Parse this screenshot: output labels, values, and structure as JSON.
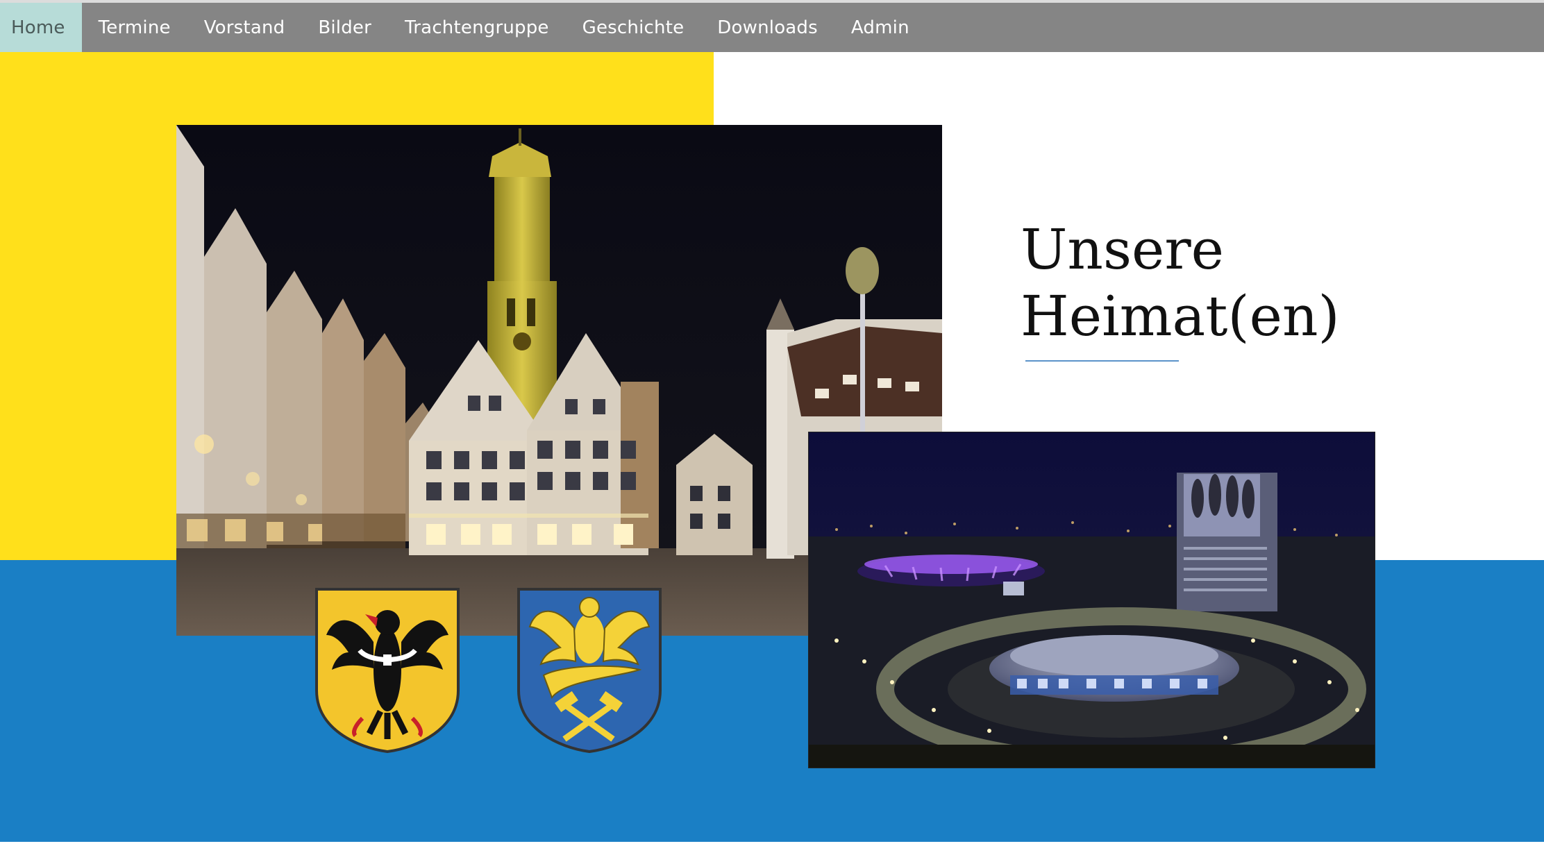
{
  "nav": {
    "items": [
      {
        "label": "Home",
        "active": true
      },
      {
        "label": "Termine"
      },
      {
        "label": "Vorstand"
      },
      {
        "label": "Bilder"
      },
      {
        "label": "Trachtengruppe"
      },
      {
        "label": "Geschichte"
      },
      {
        "label": "Downloads"
      },
      {
        "label": "Admin"
      }
    ]
  },
  "hero": {
    "title_line1": "Unsere",
    "title_line2": "Heimat(en)"
  },
  "colors": {
    "yellow": "#ffe01b",
    "blue": "#1a7fc5",
    "nav_bg": "#787878",
    "nav_active": "#b7dcd8",
    "accent_rule": "#5b93c9"
  },
  "images": {
    "town": "old-town-market-square-night-photo",
    "city": "modern-city-roundabout-night-photo",
    "crest_left": "black-eagle-coat-of-arms-icon",
    "crest_right": "golden-eagle-hammer-coat-of-arms-icon"
  }
}
